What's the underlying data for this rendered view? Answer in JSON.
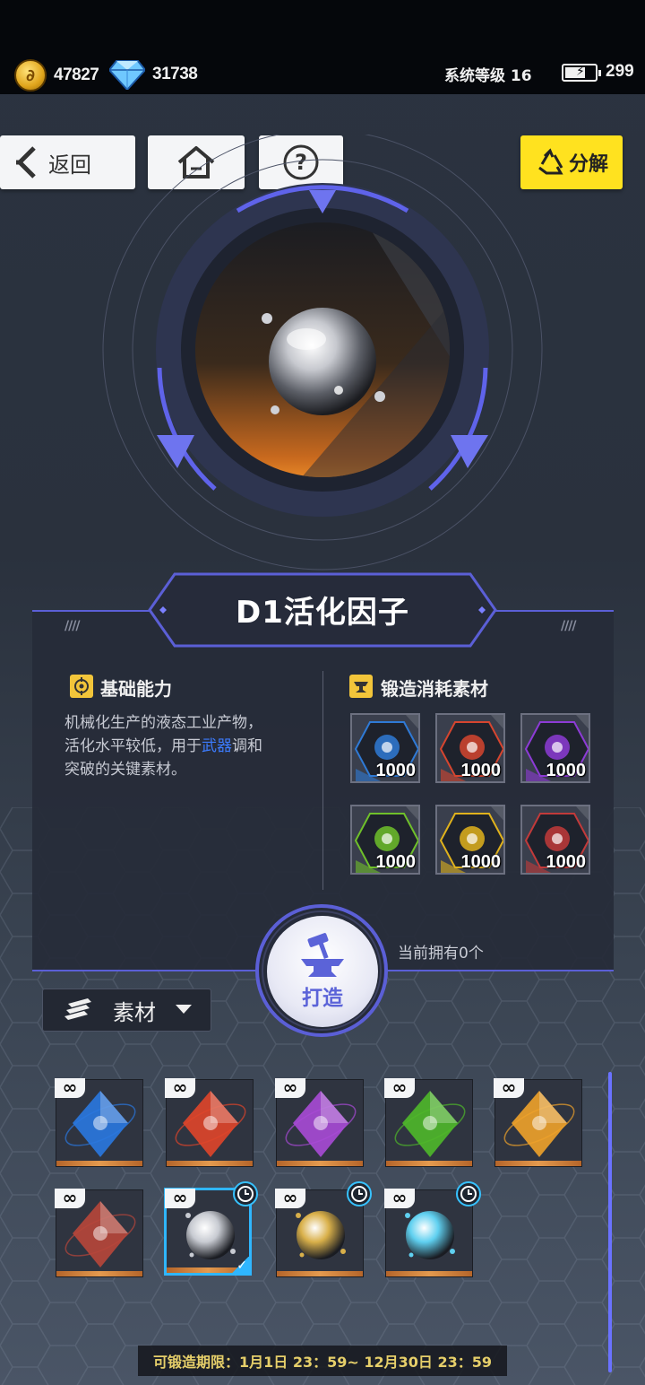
{
  "status": {
    "coins": "47827",
    "diamonds": "31738",
    "system_level": "系统等级 16",
    "energy": "299"
  },
  "nav": {
    "back_label": "返回",
    "decompose_label": "分解"
  },
  "item": {
    "title": "D1活化因子",
    "basic_section_title": "基础能力",
    "desc_line1": "机械化生产的液态工业产物，",
    "desc_line2_pre": "活化水平较低，用于",
    "desc_line2_highlight": "武器",
    "desc_line2_post": "调和",
    "desc_line3": "突破的关键素材。",
    "materials_section_title": "锻造消耗素材",
    "materials": [
      {
        "name": "blue-element",
        "qty": "1000",
        "color": "#2f7ad6"
      },
      {
        "name": "red-element",
        "qty": "1000",
        "color": "#d6452f"
      },
      {
        "name": "purple-element",
        "qty": "1000",
        "color": "#8d3bd6"
      },
      {
        "name": "green-element",
        "qty": "1000",
        "color": "#6fc02a"
      },
      {
        "name": "yellow-element",
        "qty": "1000",
        "color": "#e0b21c"
      },
      {
        "name": "crimson-element",
        "qty": "1000",
        "color": "#c23a3a"
      }
    ],
    "owned_text": "当前拥有0个"
  },
  "forge": {
    "label": "打造"
  },
  "filter": {
    "label": "素材"
  },
  "inventory": [
    {
      "name": "blue-crystal",
      "badge": "∞",
      "color": "#2a78e0",
      "clock": false,
      "selected": false
    },
    {
      "name": "red-crystal",
      "badge": "∞",
      "color": "#e0452a",
      "clock": false,
      "selected": false
    },
    {
      "name": "purple-crystal",
      "badge": "∞",
      "color": "#a84ad6",
      "clock": false,
      "selected": false
    },
    {
      "name": "green-crystal",
      "badge": "∞",
      "color": "#4fb82a",
      "clock": false,
      "selected": false
    },
    {
      "name": "orange-crystal",
      "badge": "∞",
      "color": "#f0a22a",
      "clock": false,
      "selected": false
    },
    {
      "name": "crimson-crystal",
      "badge": "∞",
      "color": "#b8463a",
      "clock": false,
      "selected": false
    },
    {
      "name": "silver-orb",
      "badge": "∞",
      "color": "#c8cbd2",
      "clock": true,
      "selected": true
    },
    {
      "name": "gold-orb",
      "badge": "∞",
      "color": "#d9b04a",
      "clock": true,
      "selected": false
    },
    {
      "name": "cyan-orb",
      "badge": "∞",
      "color": "#5fd0f0",
      "clock": true,
      "selected": false
    }
  ],
  "period_text": "可锻造期限：1月1日 23：59~ 12月30日 23：59",
  "colors": {
    "accent": "#5b5fd6",
    "decompose": "#ffe21f",
    "highlight": "#3c7cff"
  }
}
